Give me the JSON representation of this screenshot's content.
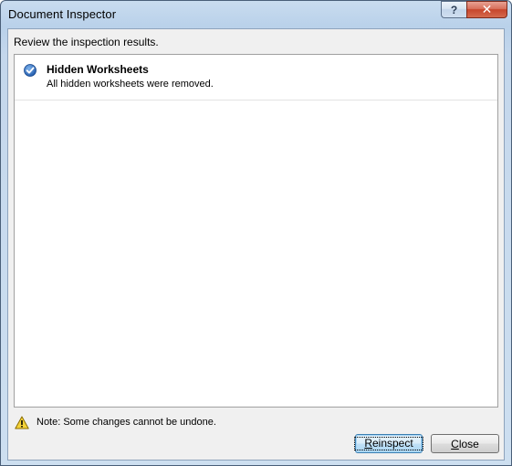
{
  "window": {
    "title": "Document Inspector",
    "help_glyph": "?",
    "close_glyph": "✕"
  },
  "instruction": "Review the inspection results.",
  "results": [
    {
      "icon": "check-circle-icon",
      "title": "Hidden Worksheets",
      "description": "All hidden worksheets were removed."
    }
  ],
  "note": {
    "icon": "warning-icon",
    "text": "Note: Some changes cannot be undone."
  },
  "buttons": {
    "reinspect": {
      "mnemonic": "R",
      "rest": "einspect"
    },
    "close": {
      "mnemonic": "C",
      "rest": "lose"
    }
  },
  "colors": {
    "check_blue": "#2f6fc4",
    "warning_yellow": "#f5d33a"
  }
}
